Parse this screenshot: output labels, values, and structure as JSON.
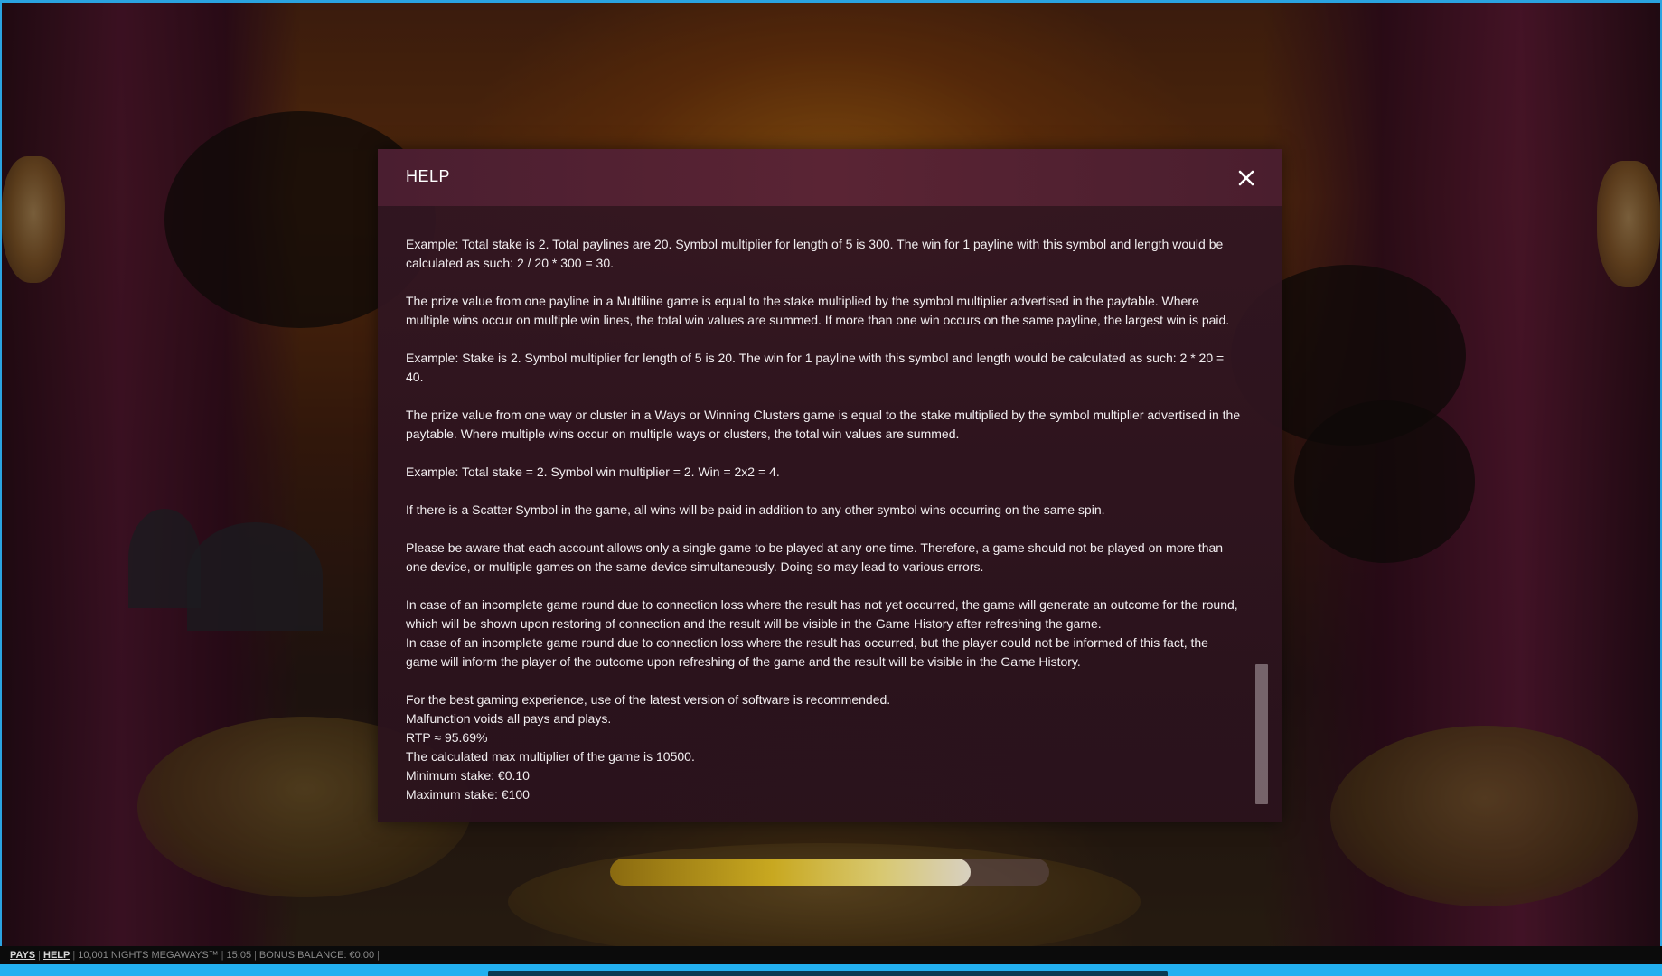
{
  "dialog": {
    "title": "HELP",
    "paragraphs": [
      [
        "Example: Total stake is 2. Total paylines are 20. Symbol multiplier for length of 5 is 300. The win for 1 payline with this symbol and length would be",
        "calculated as such: 2 / 20 * 300 = 30."
      ],
      [
        "The prize value from one payline in a Multiline game is equal to the stake multiplied by the symbol multiplier advertised in the paytable. Where",
        "multiple wins occur on multiple win lines, the total win values are summed. If more than one win occurs on the same payline, the largest win is paid."
      ],
      [
        "Example: Stake is 2. Symbol multiplier for length of 5 is 20. The win for 1 payline with this symbol and length would be calculated as such: 2 * 20 =",
        "40."
      ],
      [
        "The prize value from one way or cluster in a Ways or Winning Clusters game is equal to the stake multiplied by the symbol multiplier advertised in the",
        "paytable. Where multiple wins occur on multiple ways or clusters, the total win values are summed."
      ],
      [
        "Example: Total stake = 2. Symbol win multiplier = 2. Win = 2x2 = 4."
      ],
      [
        "If there is a Scatter Symbol in the game, all wins will be paid in addition to any other symbol wins occurring on the same spin."
      ],
      [
        "Please be aware that each account allows only a single game to be played at any one time. Therefore, a game should not be played on more than",
        "one device, or multiple games on the same device simultaneously. Doing so may lead to various errors."
      ],
      [
        "In case of an incomplete game round due to connection loss where the result has not yet occurred, the game will generate an outcome for the round,",
        "which will be shown upon restoring of connection and the result will be visible in the Game History after refreshing the game.",
        "In case of an incomplete game round due to connection loss where the result has occurred, but the player could not be informed of this fact, the",
        "game will inform the player of the outcome upon refreshing of the game and the result will be visible in the Game History."
      ],
      [
        "For the best gaming experience, use of the latest version of software is recommended.",
        "Malfunction voids all pays and plays.",
        "RTP ≈ 95.69%",
        "The calculated max multiplier of the game is 10500.",
        "Minimum stake: €0.10",
        "Maximum stake: €100"
      ]
    ]
  },
  "loading": {
    "progress": 0.82,
    "colors": {
      "fill_start": "#8a6a10",
      "fill_end": "#d8d0c0"
    }
  },
  "status_bar": {
    "pays_label": "PAYS",
    "help_label": "HELP",
    "game_name": "10,001 NIGHTS MEGAWAYS™",
    "time": "15:05",
    "bonus_balance": "BONUS BALANCE: €0.00"
  },
  "icons": {
    "close": "close-icon"
  },
  "colors": {
    "frame_accent": "#2aa3e0",
    "dialog_bg": "#321622",
    "text": "#f2eef0"
  }
}
